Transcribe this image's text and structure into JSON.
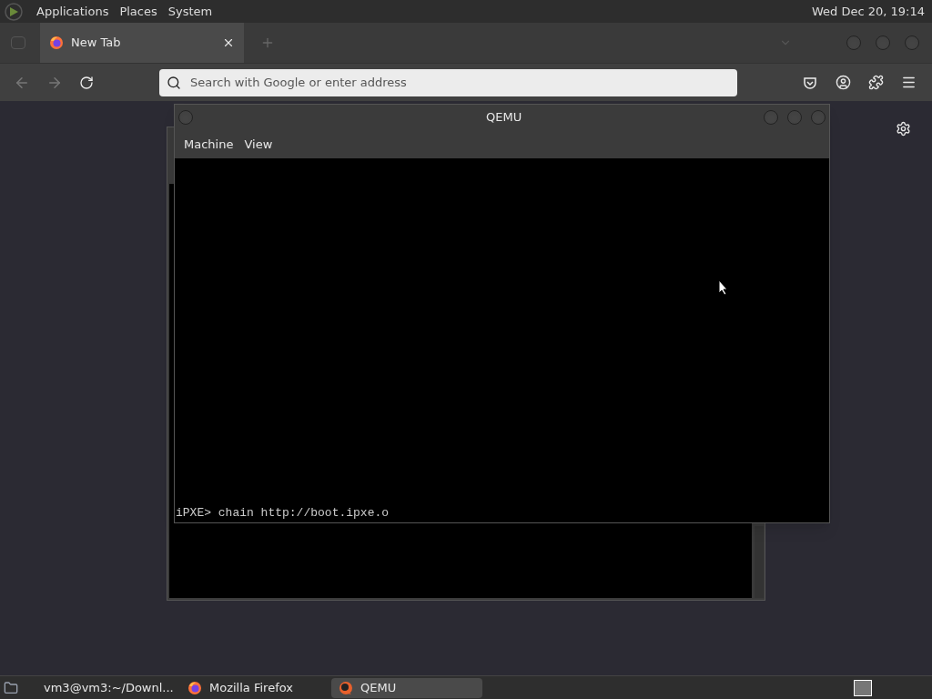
{
  "top_panel": {
    "menus": [
      "Applications",
      "Places",
      "System"
    ],
    "clock": "Wed Dec 20, 19:14"
  },
  "browser": {
    "tabs": [
      {
        "title": "New Tab",
        "selected": true
      }
    ],
    "address": {
      "placeholder": "Search with Google or enter address"
    }
  },
  "qemu": {
    "title": "QEMU",
    "menus": [
      "Machine",
      "View"
    ],
    "console_line": "iPXE> chain http://boot.ipxe.o"
  },
  "taskbar": {
    "items": [
      {
        "kind": "terminal",
        "label": "vm3@vm3:~/Downl...",
        "selected": false
      },
      {
        "kind": "firefox",
        "label": "Mozilla Firefox",
        "selected": false
      },
      {
        "kind": "qemu",
        "label": "QEMU",
        "selected": true
      }
    ]
  }
}
